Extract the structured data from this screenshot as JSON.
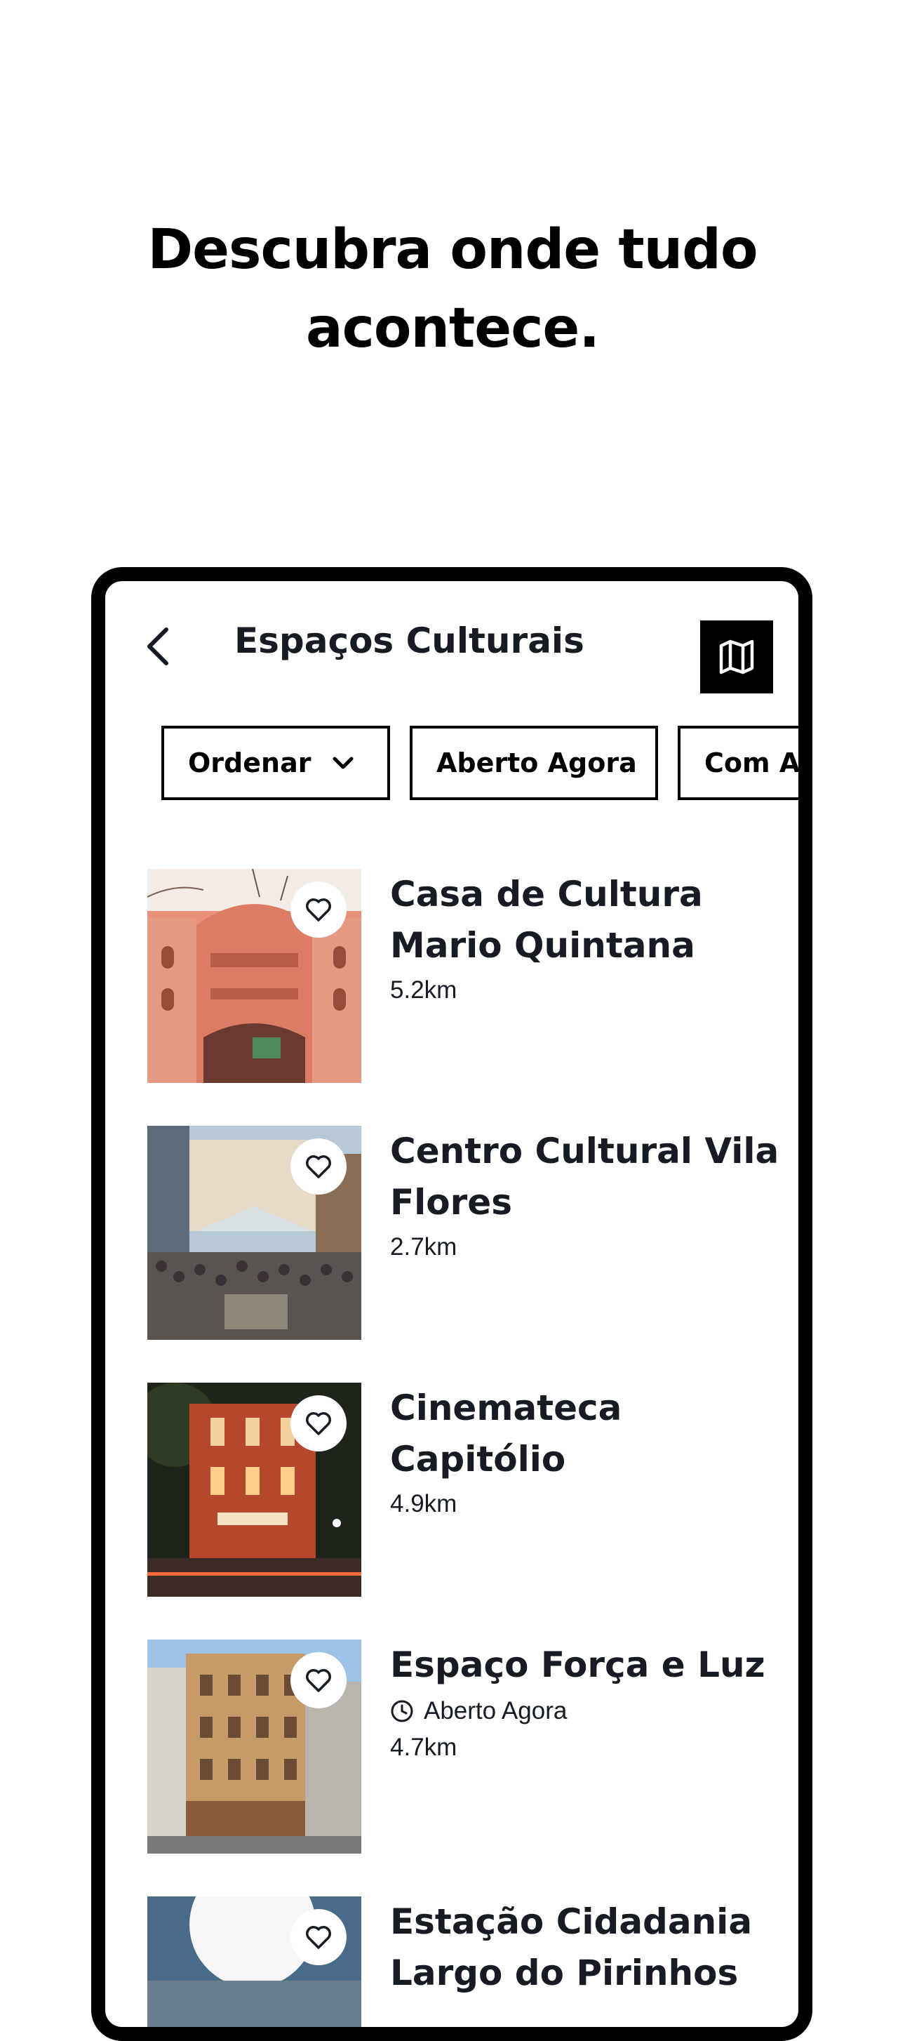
{
  "headline": [
    "Descubra onde tudo",
    "acontece."
  ],
  "app": {
    "title": "Espaços Culturais",
    "icons": {
      "back": "chevron-left-icon",
      "map": "map-icon",
      "favorite": "heart-icon",
      "clock": "clock-icon",
      "dropdown": "chevron-down-icon"
    }
  },
  "filters": {
    "sort_label": "Ordenar",
    "open_now_label": "Aberto Agora",
    "more_label": "Com Acessibilidade"
  },
  "places": [
    {
      "name": "Casa de Cultura Mario Quintana",
      "status": "",
      "distance": "5.2km"
    },
    {
      "name": "Centro Cultural Vila Flores",
      "status": "",
      "distance": "2.7km"
    },
    {
      "name": "Cinemateca Capitólio",
      "status": "",
      "distance": "4.9km"
    },
    {
      "name": "Espaço Força e Luz",
      "status": "Aberto Agora",
      "distance": "4.7km"
    },
    {
      "name": "Estação Cidadania Largo do Pirinhos",
      "status": "",
      "distance": ""
    }
  ],
  "colors": {
    "accent": "#000000",
    "text": "#161b24",
    "background": "#ffffff"
  }
}
